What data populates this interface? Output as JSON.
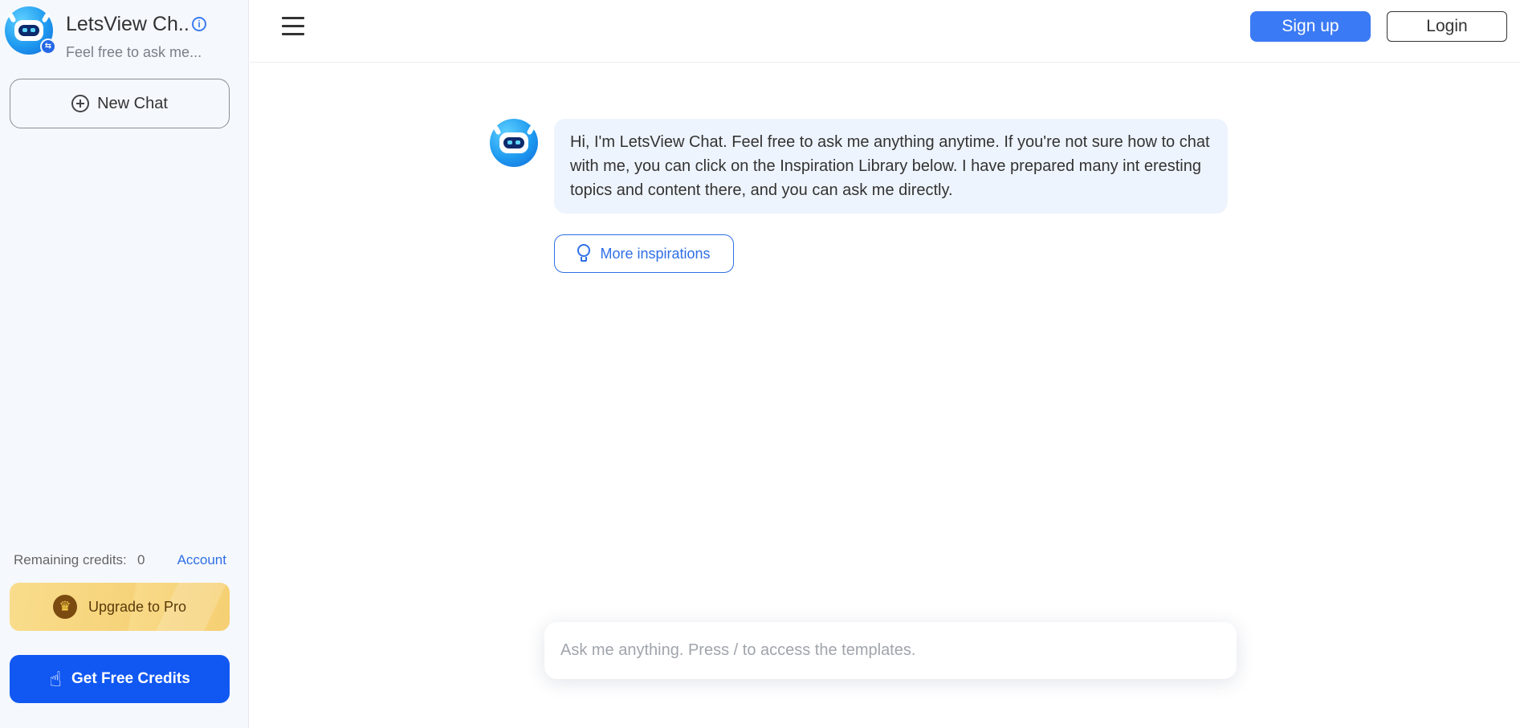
{
  "sidebar": {
    "app_title": "LetsView Ch...",
    "app_subtitle": "Feel free to ask me...",
    "new_chat_label": "New Chat",
    "credits_label": "Remaining credits:",
    "credits_value": "0",
    "account_label": "Account",
    "upgrade_label": "Upgrade to Pro",
    "free_credits_label": "Get Free Credits"
  },
  "header": {
    "signup_label": "Sign up",
    "login_label": "Login"
  },
  "chat": {
    "bot_message": "Hi, I'm LetsView Chat. Feel free to ask me anything anytime. If you're not sure how to chat with me, you can click on the Inspiration Library below. I have prepared many int eresting topics and content there, and you can ask me directly.",
    "inspirations_label": "More inspirations",
    "input_placeholder": "Ask me anything. Press / to access the templates.",
    "input_value": ""
  },
  "icons": {
    "info": "info-icon",
    "plus": "plus-circle-icon",
    "crown": "crown-icon",
    "hand": "hand-pointer-icon",
    "menu": "hamburger-menu-icon",
    "bulb": "lightbulb-icon",
    "robot": "robot-avatar-icon"
  },
  "colors": {
    "accent": "#3b7af5",
    "free_credits_bg": "#1158f2",
    "upgrade_bg": "#f7d67e",
    "bubble_bg": "#eef4fd",
    "sidebar_bg": "#f5f8fd"
  }
}
